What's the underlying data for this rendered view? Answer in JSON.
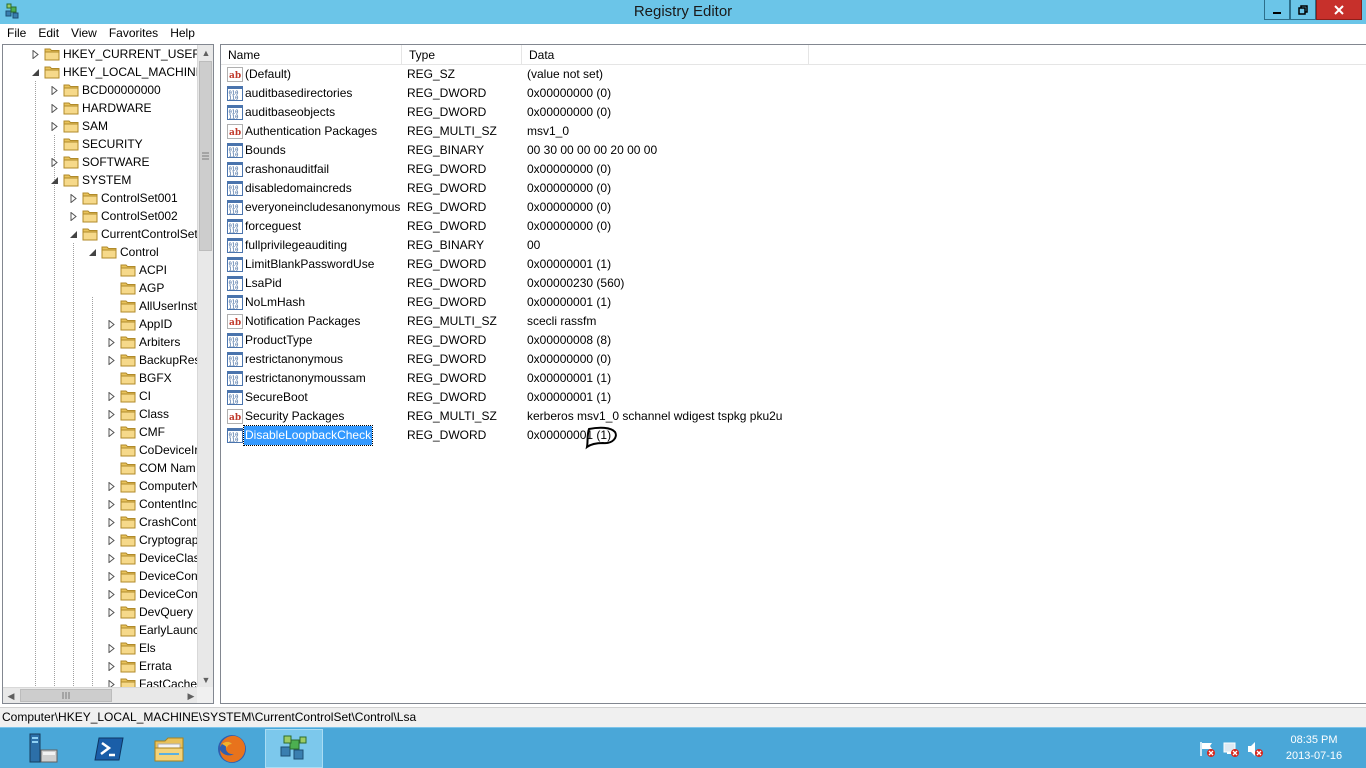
{
  "window": {
    "title": "Registry Editor"
  },
  "menu": [
    "File",
    "Edit",
    "View",
    "Favorites",
    "Help"
  ],
  "tree": [
    {
      "label": "HKEY_CURRENT_USER",
      "level": 0,
      "exp": "closed"
    },
    {
      "label": "HKEY_LOCAL_MACHINE",
      "level": 0,
      "exp": "open"
    },
    {
      "label": "BCD00000000",
      "level": 1,
      "exp": "closed"
    },
    {
      "label": "HARDWARE",
      "level": 1,
      "exp": "closed"
    },
    {
      "label": "SAM",
      "level": 1,
      "exp": "closed"
    },
    {
      "label": "SECURITY",
      "level": 1,
      "exp": "none"
    },
    {
      "label": "SOFTWARE",
      "level": 1,
      "exp": "closed"
    },
    {
      "label": "SYSTEM",
      "level": 1,
      "exp": "open"
    },
    {
      "label": "ControlSet001",
      "level": 2,
      "exp": "closed"
    },
    {
      "label": "ControlSet002",
      "level": 2,
      "exp": "closed"
    },
    {
      "label": "CurrentControlSet",
      "level": 2,
      "exp": "open"
    },
    {
      "label": "Control",
      "level": 3,
      "exp": "open"
    },
    {
      "label": "ACPI",
      "level": 4,
      "exp": "none"
    },
    {
      "label": "AGP",
      "level": 4,
      "exp": "none"
    },
    {
      "label": "AllUserInst",
      "level": 4,
      "exp": "none"
    },
    {
      "label": "AppID",
      "level": 4,
      "exp": "closed"
    },
    {
      "label": "Arbiters",
      "level": 4,
      "exp": "closed"
    },
    {
      "label": "BackupRes",
      "level": 4,
      "exp": "closed"
    },
    {
      "label": "BGFX",
      "level": 4,
      "exp": "none"
    },
    {
      "label": "CI",
      "level": 4,
      "exp": "closed"
    },
    {
      "label": "Class",
      "level": 4,
      "exp": "closed"
    },
    {
      "label": "CMF",
      "level": 4,
      "exp": "closed"
    },
    {
      "label": "CoDeviceIr",
      "level": 4,
      "exp": "none"
    },
    {
      "label": "COM Nam",
      "level": 4,
      "exp": "none"
    },
    {
      "label": "ComputerN",
      "level": 4,
      "exp": "closed"
    },
    {
      "label": "ContentInc",
      "level": 4,
      "exp": "closed"
    },
    {
      "label": "CrashCont",
      "level": 4,
      "exp": "closed"
    },
    {
      "label": "Cryptograp",
      "level": 4,
      "exp": "closed"
    },
    {
      "label": "DeviceClas",
      "level": 4,
      "exp": "closed"
    },
    {
      "label": "DeviceCon",
      "level": 4,
      "exp": "closed"
    },
    {
      "label": "DeviceCon",
      "level": 4,
      "exp": "closed"
    },
    {
      "label": "DevQuery",
      "level": 4,
      "exp": "closed"
    },
    {
      "label": "EarlyLaunc",
      "level": 4,
      "exp": "none"
    },
    {
      "label": "Els",
      "level": 4,
      "exp": "closed"
    },
    {
      "label": "Errata",
      "level": 4,
      "exp": "closed"
    },
    {
      "label": "FastCache",
      "level": 4,
      "exp": "closed"
    }
  ],
  "columns": {
    "name": "Name",
    "type": "Type",
    "data": "Data"
  },
  "values": [
    {
      "name": "(Default)",
      "type": "REG_SZ",
      "data": "(value not set)",
      "icon": "string"
    },
    {
      "name": "auditbasedirectories",
      "type": "REG_DWORD",
      "data": "0x00000000 (0)",
      "icon": "binary"
    },
    {
      "name": "auditbaseobjects",
      "type": "REG_DWORD",
      "data": "0x00000000 (0)",
      "icon": "binary"
    },
    {
      "name": "Authentication Packages",
      "type": "REG_MULTI_SZ",
      "data": "msv1_0",
      "icon": "string"
    },
    {
      "name": "Bounds",
      "type": "REG_BINARY",
      "data": "00 30 00 00 00 20 00 00",
      "icon": "binary"
    },
    {
      "name": "crashonauditfail",
      "type": "REG_DWORD",
      "data": "0x00000000 (0)",
      "icon": "binary"
    },
    {
      "name": "disabledomaincreds",
      "type": "REG_DWORD",
      "data": "0x00000000 (0)",
      "icon": "binary"
    },
    {
      "name": "everyoneincludesanonymous",
      "type": "REG_DWORD",
      "data": "0x00000000 (0)",
      "icon": "binary"
    },
    {
      "name": "forceguest",
      "type": "REG_DWORD",
      "data": "0x00000000 (0)",
      "icon": "binary"
    },
    {
      "name": "fullprivilegeauditing",
      "type": "REG_BINARY",
      "data": "00",
      "icon": "binary"
    },
    {
      "name": "LimitBlankPasswordUse",
      "type": "REG_DWORD",
      "data": "0x00000001 (1)",
      "icon": "binary"
    },
    {
      "name": "LsaPid",
      "type": "REG_DWORD",
      "data": "0x00000230 (560)",
      "icon": "binary"
    },
    {
      "name": "NoLmHash",
      "type": "REG_DWORD",
      "data": "0x00000001 (1)",
      "icon": "binary"
    },
    {
      "name": "Notification Packages",
      "type": "REG_MULTI_SZ",
      "data": "scecli rassfm",
      "icon": "string"
    },
    {
      "name": "ProductType",
      "type": "REG_DWORD",
      "data": "0x00000008 (8)",
      "icon": "binary"
    },
    {
      "name": "restrictanonymous",
      "type": "REG_DWORD",
      "data": "0x00000000 (0)",
      "icon": "binary"
    },
    {
      "name": "restrictanonymoussam",
      "type": "REG_DWORD",
      "data": "0x00000001 (1)",
      "icon": "binary"
    },
    {
      "name": "SecureBoot",
      "type": "REG_DWORD",
      "data": "0x00000001 (1)",
      "icon": "binary"
    },
    {
      "name": "Security Packages",
      "type": "REG_MULTI_SZ",
      "data": "kerberos msv1_0 schannel wdigest tspkg pku2u",
      "icon": "string"
    },
    {
      "name": "DisableLoopbackCheck",
      "type": "REG_DWORD",
      "data": "0x00000001 (1)",
      "icon": "binary",
      "selected": true
    }
  ],
  "status": {
    "path": "Computer\\HKEY_LOCAL_MACHINE\\SYSTEM\\CurrentControlSet\\Control\\Lsa"
  },
  "taskbar": {
    "apps": [
      "server-manager",
      "powershell",
      "file-explorer",
      "firefox",
      "registry-editor"
    ],
    "active": "registry-editor",
    "time": "08:35 PM",
    "date": "2013-07-16"
  },
  "colors": {
    "titlebar": "#6bc5e8",
    "taskbar": "#4aa7d8",
    "selection": "#3399ff",
    "close": "#c7302b"
  }
}
